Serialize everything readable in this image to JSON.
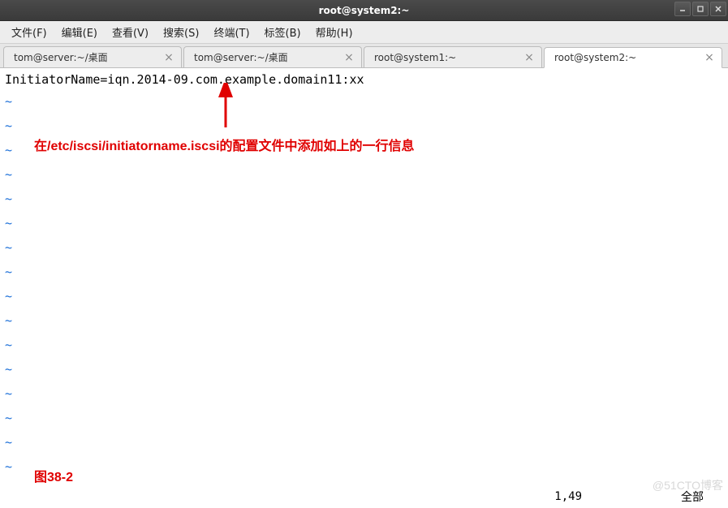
{
  "window": {
    "title": "root@system2:~"
  },
  "menu": {
    "items": [
      "文件(F)",
      "编辑(E)",
      "查看(V)",
      "搜索(S)",
      "终端(T)",
      "标签(B)",
      "帮助(H)"
    ]
  },
  "tabs": {
    "items": [
      {
        "label": "tom@server:~/桌面",
        "active": false
      },
      {
        "label": "tom@server:~/桌面",
        "active": false
      },
      {
        "label": "root@system1:~",
        "active": false
      },
      {
        "label": "root@system2:~",
        "active": true
      }
    ]
  },
  "terminal": {
    "content": "InitiatorName=iqn.2014-09.com.example.domain11:xx",
    "tilde": "~"
  },
  "annotations": {
    "main": "在/etc/iscsi/initiatorname.iscsi的配置文件中添加如上的一行信息",
    "figure_label": "图38-2"
  },
  "status": {
    "cursor": "1,49",
    "mode": "全部"
  },
  "watermark": "@51CTO博客"
}
